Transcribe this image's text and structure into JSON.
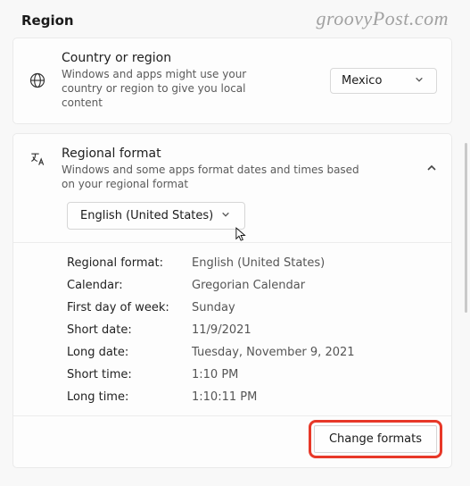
{
  "page": {
    "title": "Region"
  },
  "watermark": "groovyPost.com",
  "country": {
    "heading": "Country or region",
    "description": "Windows and apps might use your country or region to give you local content",
    "selected": "Mexico"
  },
  "regional": {
    "heading": "Regional format",
    "description": "Windows and some apps format dates and times based on your regional format",
    "selected": "English (United States)"
  },
  "details": {
    "rows": [
      {
        "label": "Regional format:",
        "value": "English (United States)"
      },
      {
        "label": "Calendar:",
        "value": "Gregorian Calendar"
      },
      {
        "label": "First day of week:",
        "value": "Sunday"
      },
      {
        "label": "Short date:",
        "value": "11/9/2021"
      },
      {
        "label": "Long date:",
        "value": "Tuesday, November 9, 2021"
      },
      {
        "label": "Short time:",
        "value": "1:10 PM"
      },
      {
        "label": "Long time:",
        "value": "1:10:11 PM"
      }
    ]
  },
  "footer": {
    "change_formats": "Change formats"
  }
}
